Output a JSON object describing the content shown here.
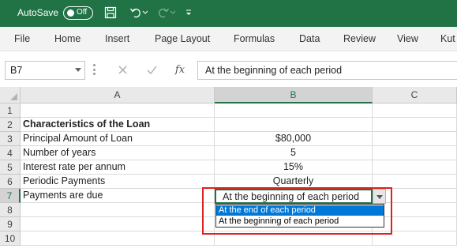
{
  "titlebar": {
    "autosave_label": "AutoSave",
    "autosave_state": "Off",
    "icons": [
      "save-icon",
      "undo-icon",
      "redo-icon",
      "customize-qat-icon"
    ]
  },
  "ribbon": {
    "tabs": [
      "File",
      "Home",
      "Insert",
      "Page Layout",
      "Formulas",
      "Data",
      "Review",
      "View",
      "Kut"
    ]
  },
  "formula_bar": {
    "name_box": "B7",
    "fx_label": "fx",
    "value": "At the beginning of each period"
  },
  "columns": [
    "A",
    "B",
    "C"
  ],
  "rows": [
    "1",
    "2",
    "3",
    "4",
    "5",
    "6",
    "7",
    "8",
    "9",
    "10"
  ],
  "cells": {
    "A2": "Characteristics of the Loan",
    "A3": "Principal Amount of Loan",
    "B3": "$80,000",
    "A4": "Number of years",
    "B4": "5",
    "A5": "Interest rate per annum",
    "B5": "15%",
    "A6": "Periodic Payments",
    "B6": "Quarterly",
    "A7": "Payments are due",
    "B7": "At the beginning of each period"
  },
  "dropdown": {
    "options": [
      "At the end of each period",
      "At the beginning of each period"
    ],
    "highlighted_index": 0
  },
  "colors": {
    "excel_green": "#217346",
    "highlight_red": "#e02020",
    "selection_blue": "#0078d7"
  }
}
